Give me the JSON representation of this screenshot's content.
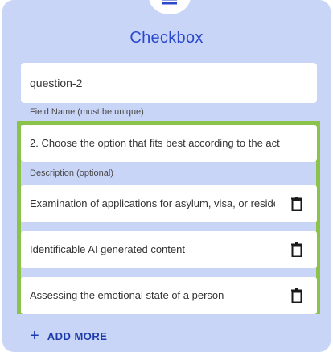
{
  "card": {
    "title": "Checkbox"
  },
  "field_name": {
    "value": "question-2",
    "helper": "Field Name (must be unique)"
  },
  "description": {
    "value": "2. Choose the option that fits best according to the act",
    "helper": "Description (optional)"
  },
  "options": [
    {
      "label": "Examination of applications for asylum, visa, or residence"
    },
    {
      "label": "Identificable AI generated content"
    },
    {
      "label": "Assessing the emotional state of a person"
    }
  ],
  "add_more": {
    "label": "ADD MORE",
    "icon": "plus-icon"
  },
  "colors": {
    "card_bg": "#c9d5f7",
    "accent": "#2b4acb",
    "highlight_border": "#8bc34a"
  }
}
